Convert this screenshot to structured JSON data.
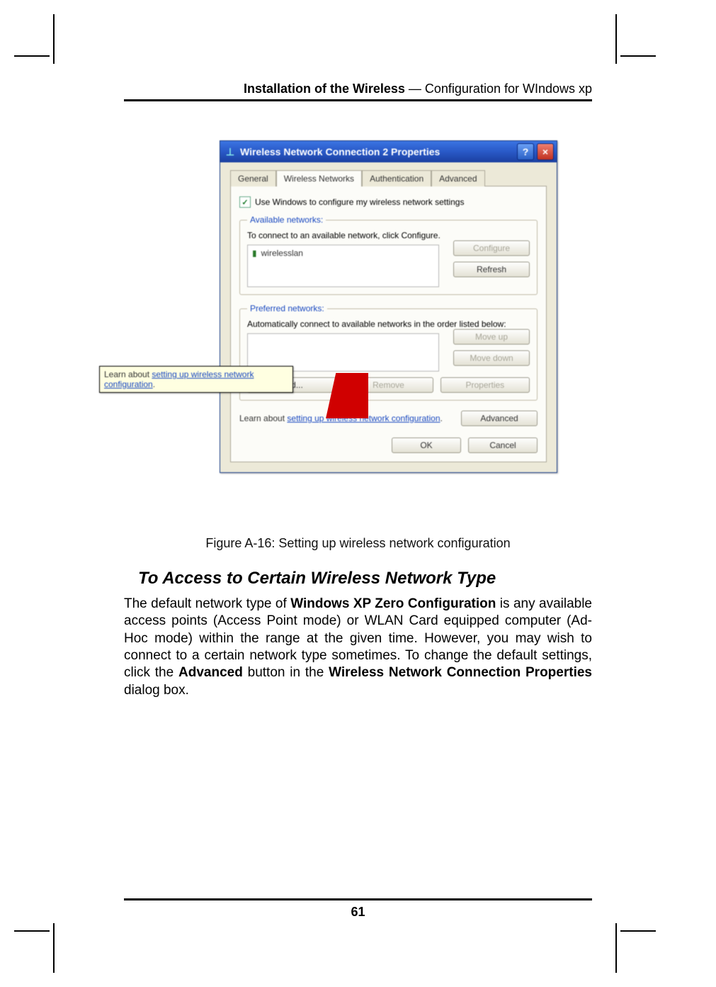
{
  "header": {
    "bold": "Installation of the Wireless",
    "sep": " — ",
    "rest": "Configuration for WIndows xp"
  },
  "dialog": {
    "title": "Wireless Network Connection 2 Properties",
    "help_label": "?",
    "close_label": "×",
    "tabs": {
      "general": "General",
      "wireless": "Wireless Networks",
      "auth": "Authentication",
      "advanced": "Advanced"
    },
    "use_windows_checkbox": "Use Windows to configure my wireless network settings",
    "available": {
      "legend": "Available networks:",
      "hint": "To connect to an available network, click Configure.",
      "item": "wirelesslan",
      "configure_btn": "Configure",
      "refresh_btn": "Refresh"
    },
    "preferred": {
      "legend": "Preferred networks:",
      "hint": "Automatically connect to available networks in the order listed below:",
      "moveup_btn": "Move up",
      "movedown_btn": "Move down",
      "add_btn": "Add...",
      "remove_btn": "Remove",
      "properties_btn": "Properties"
    },
    "learn": {
      "prefix": "Learn about ",
      "link": "setting up wireless network configuration",
      "suffix": ".",
      "advanced_btn": "Advanced"
    },
    "ok_btn": "OK",
    "cancel_btn": "Cancel"
  },
  "tooltip": {
    "prefix": "Learn about ",
    "link": "setting up wireless network configuration",
    "suffix": "."
  },
  "caption": "Figure A-16: Setting up wireless network configuration",
  "section_heading": "To Access to Certain Wireless Network Type",
  "body": {
    "p1a": "The default network type of ",
    "p1b": "Windows XP Zero Configuration",
    "p1c": " is any available access points (Access Point mode) or WLAN Card equipped computer (Ad-Hoc mode) within the range at the given time. However, you may wish to connect to a certain network type sometimes. To change the default settings, click the ",
    "p1d": "Advanced",
    "p1e": " button in the ",
    "p1f": "Wireless Network Connection Properties",
    "p1g": " dialog box."
  },
  "page_number": "61"
}
